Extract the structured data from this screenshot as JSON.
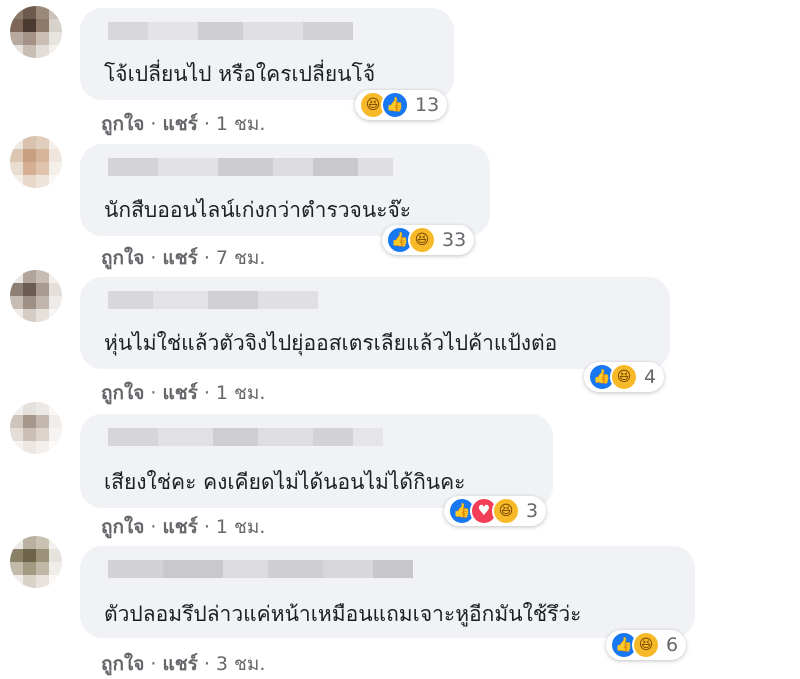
{
  "comments": [
    {
      "text": "โจ้เปลี่ยนไป หรือใครเปลี่ยนโจ้",
      "reactions": [
        "haha",
        "like"
      ],
      "reaction_count": "13",
      "like_label": "ถูกใจ",
      "share_label": "แชร์",
      "separator": "·",
      "time": "1 ชม."
    },
    {
      "text": "นักสืบออนไลน์เก่งกว่าตำรวจนะจ๊ะ",
      "reactions": [
        "like",
        "haha"
      ],
      "reaction_count": "33",
      "like_label": "ถูกใจ",
      "share_label": "แชร์",
      "separator": "·",
      "time": "7 ชม."
    },
    {
      "text": "หุ่นไม่ใช่แล้วตัวจิงไปยุ่ออสเตรเลียแล้วไปค้าแป้งต่อ",
      "reactions": [
        "like",
        "haha"
      ],
      "reaction_count": "4",
      "like_label": "ถูกใจ",
      "share_label": "แชร์",
      "separator": "·",
      "time": "1 ชม."
    },
    {
      "text": "เสียงใช่คะ คงเคียดไม่ได้นอนไม่ได้กินคะ",
      "reactions": [
        "like",
        "love",
        "haha"
      ],
      "reaction_count": "3",
      "like_label": "ถูกใจ",
      "share_label": "แชร์",
      "separator": "·",
      "time": "1 ชม."
    },
    {
      "text": "ตัวปลอมรึปล่าวแค่หน้าเหมือนแถมเจาะหูอีกมันใช้รึว่ะ",
      "reactions": [
        "like",
        "haha"
      ],
      "reaction_count": "6",
      "like_label": "ถูกใจ",
      "share_label": "แชร์",
      "separator": "·",
      "time": "3 ชม."
    }
  ],
  "icons": {
    "like": "thumbs-up-icon",
    "haha": "laughing-face-icon",
    "love": "heart-icon"
  },
  "colors": {
    "bubble": "#f0f2f5",
    "like": "#1877f2",
    "haha": "#f7b928",
    "love": "#f33e58",
    "meta_text": "#65676b"
  }
}
